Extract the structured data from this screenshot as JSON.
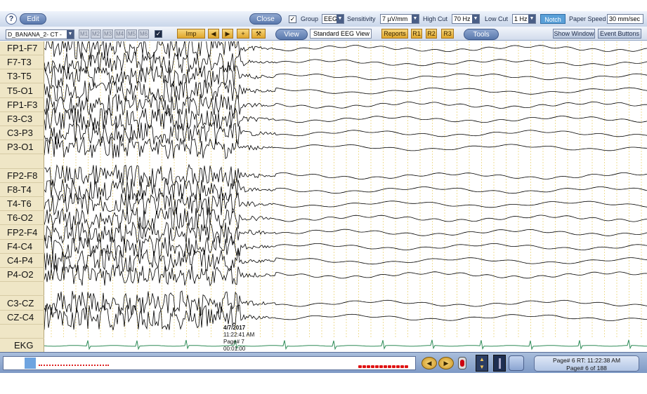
{
  "toolbar": {
    "help_icon": "question-icon",
    "edit_label": "Edit",
    "close_label": "Close",
    "group_label": "Group",
    "group_value": "EEG",
    "sensitivity_label": "Sensitivity",
    "sensitivity_value": "7 µV/mm",
    "high_cut_label": "High Cut",
    "high_cut_value": "70 Hz",
    "low_cut_label": "Low Cut",
    "low_cut_value": "1 Hz",
    "notch_label": "Notch",
    "paper_speed_label": "Paper Speed",
    "paper_speed_value": "30 mm/sec",
    "montage_value": "D_BANANA_2- CT -",
    "m_buttons": [
      "M1",
      "M2",
      "M3",
      "M4",
      "M5",
      "M6"
    ],
    "imp_label": "Imp",
    "view_label": "View",
    "view_value": "Standard EEG View",
    "reports_label": "Reports",
    "r_buttons": [
      "R1",
      "R2",
      "R3"
    ],
    "tools_label": "Tools",
    "show_window_label": "Show Window",
    "event_buttons_label": "Event Buttons"
  },
  "channels": [
    "FP1-F7",
    "F7-T3",
    "T3-T5",
    "T5-O1",
    "FP1-F3",
    "F3-C3",
    "C3-P3",
    "P3-O1",
    "",
    "FP2-F8",
    "F8-T4",
    "T4-T6",
    "T6-O2",
    "FP2-F4",
    "F4-C4",
    "C4-P4",
    "P4-O2",
    "",
    "C3-CZ",
    "CZ-C4",
    "",
    "EKG"
  ],
  "annotation": {
    "date": "4/7/2017",
    "time": "11:22:41 AM",
    "page": "Page# 7",
    "elapsed": "00:01:00"
  },
  "status": {
    "page_rt": "Page# 6  RT: 11:22:38 AM",
    "page_of": "Page# 6 of 188"
  },
  "colors": {
    "label_panel": "#efe6c6",
    "trace": "#000000",
    "ekg_trace": "#2e8b57",
    "grid": "#e8cf6a",
    "accent": "#5a79ad"
  }
}
